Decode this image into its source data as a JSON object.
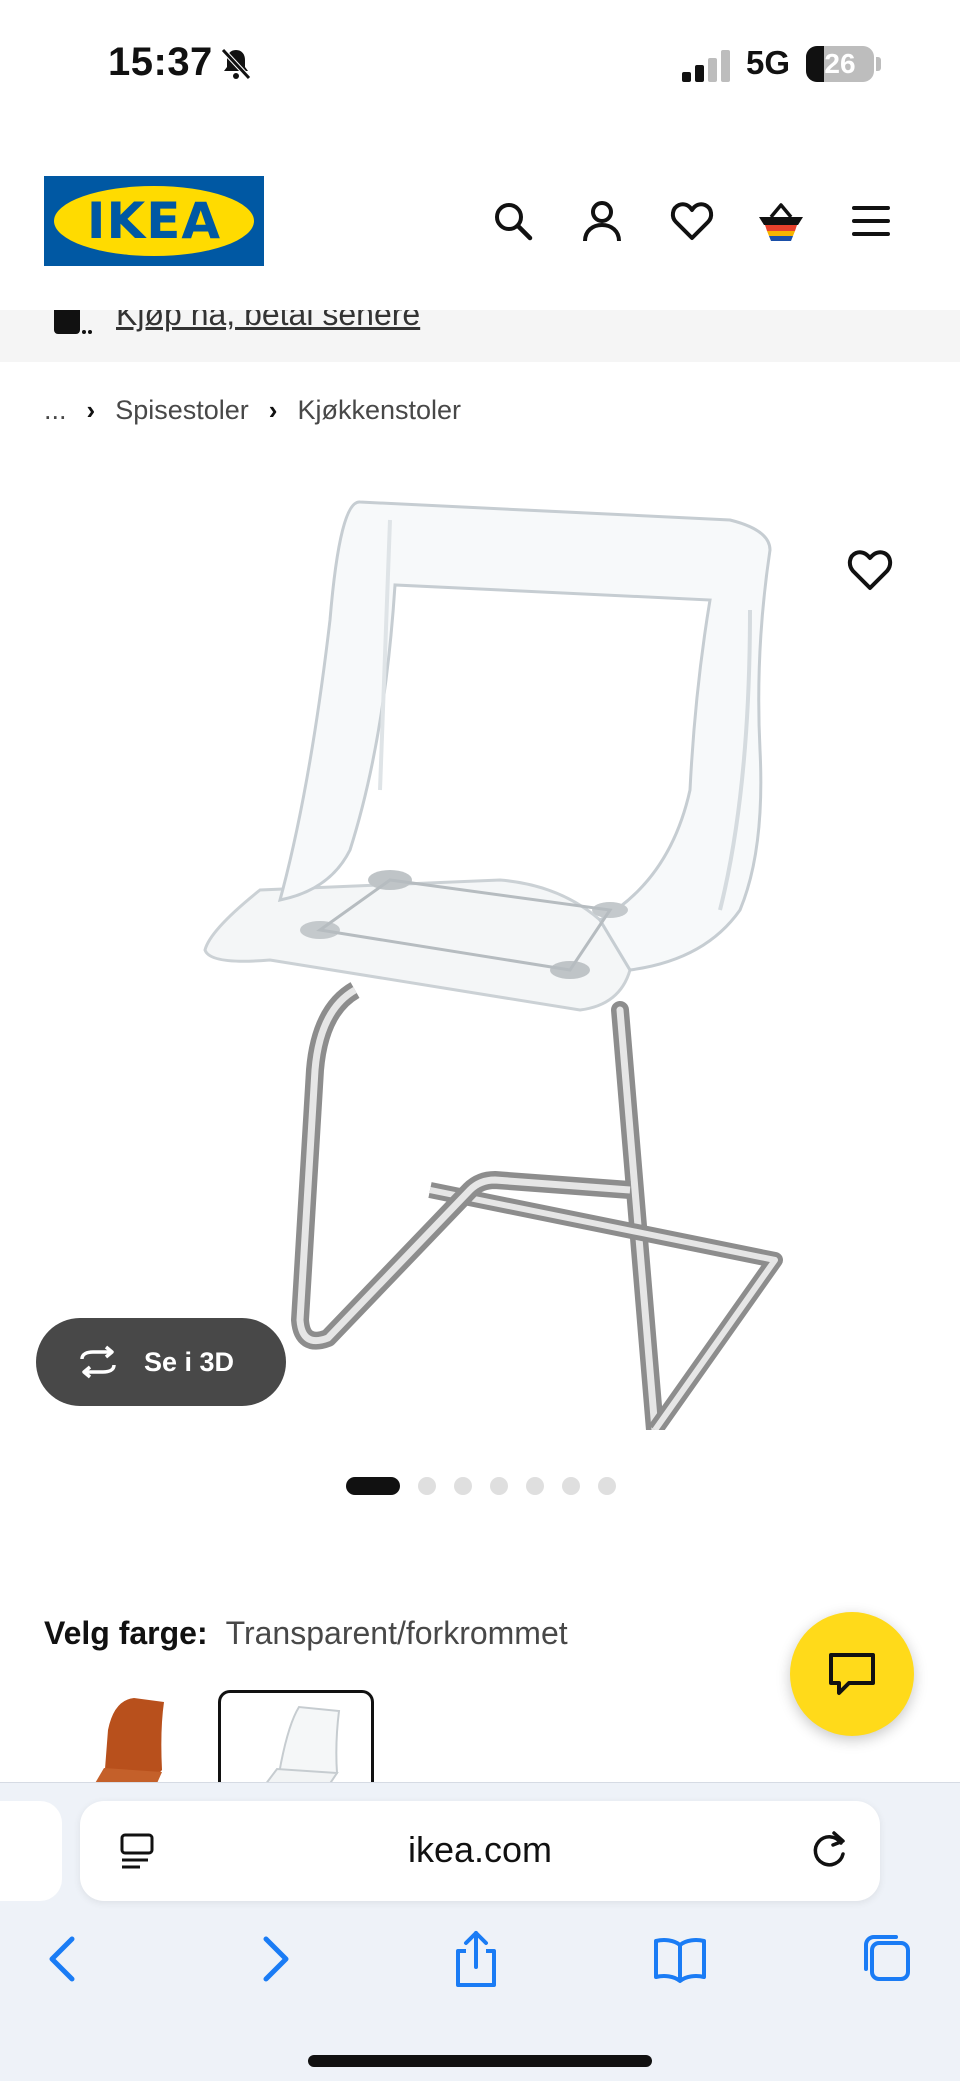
{
  "status_bar": {
    "time": "15:37",
    "network": "5G",
    "battery_level": "26",
    "battery_fraction": 0.26
  },
  "header": {
    "logo_text": "IKEA",
    "icons": [
      "search-icon",
      "account-icon",
      "heart-icon",
      "basket-icon",
      "menu-icon"
    ]
  },
  "promo": {
    "text": "Kjøp nå, betal senere"
  },
  "breadcrumb": {
    "items": [
      "...",
      "Spisestoler",
      "Kjøkkenstoler"
    ]
  },
  "product": {
    "view_3d_label": "Se i 3D",
    "image_count": 7,
    "active_image_index": 0
  },
  "color": {
    "label": "Velg farge:",
    "value": "Transparent/forkrommet",
    "swatches": [
      "brown-chair-swatch",
      "transparent-chair-swatch"
    ],
    "selected_swatch_index": 1
  },
  "browser": {
    "url": "ikea.com"
  },
  "colors": {
    "ikea_blue": "#0058a3",
    "ikea_yellow": "#ffdb00",
    "chat_yellow": "#ffda1a",
    "ios_blue": "#1a7cf5"
  }
}
